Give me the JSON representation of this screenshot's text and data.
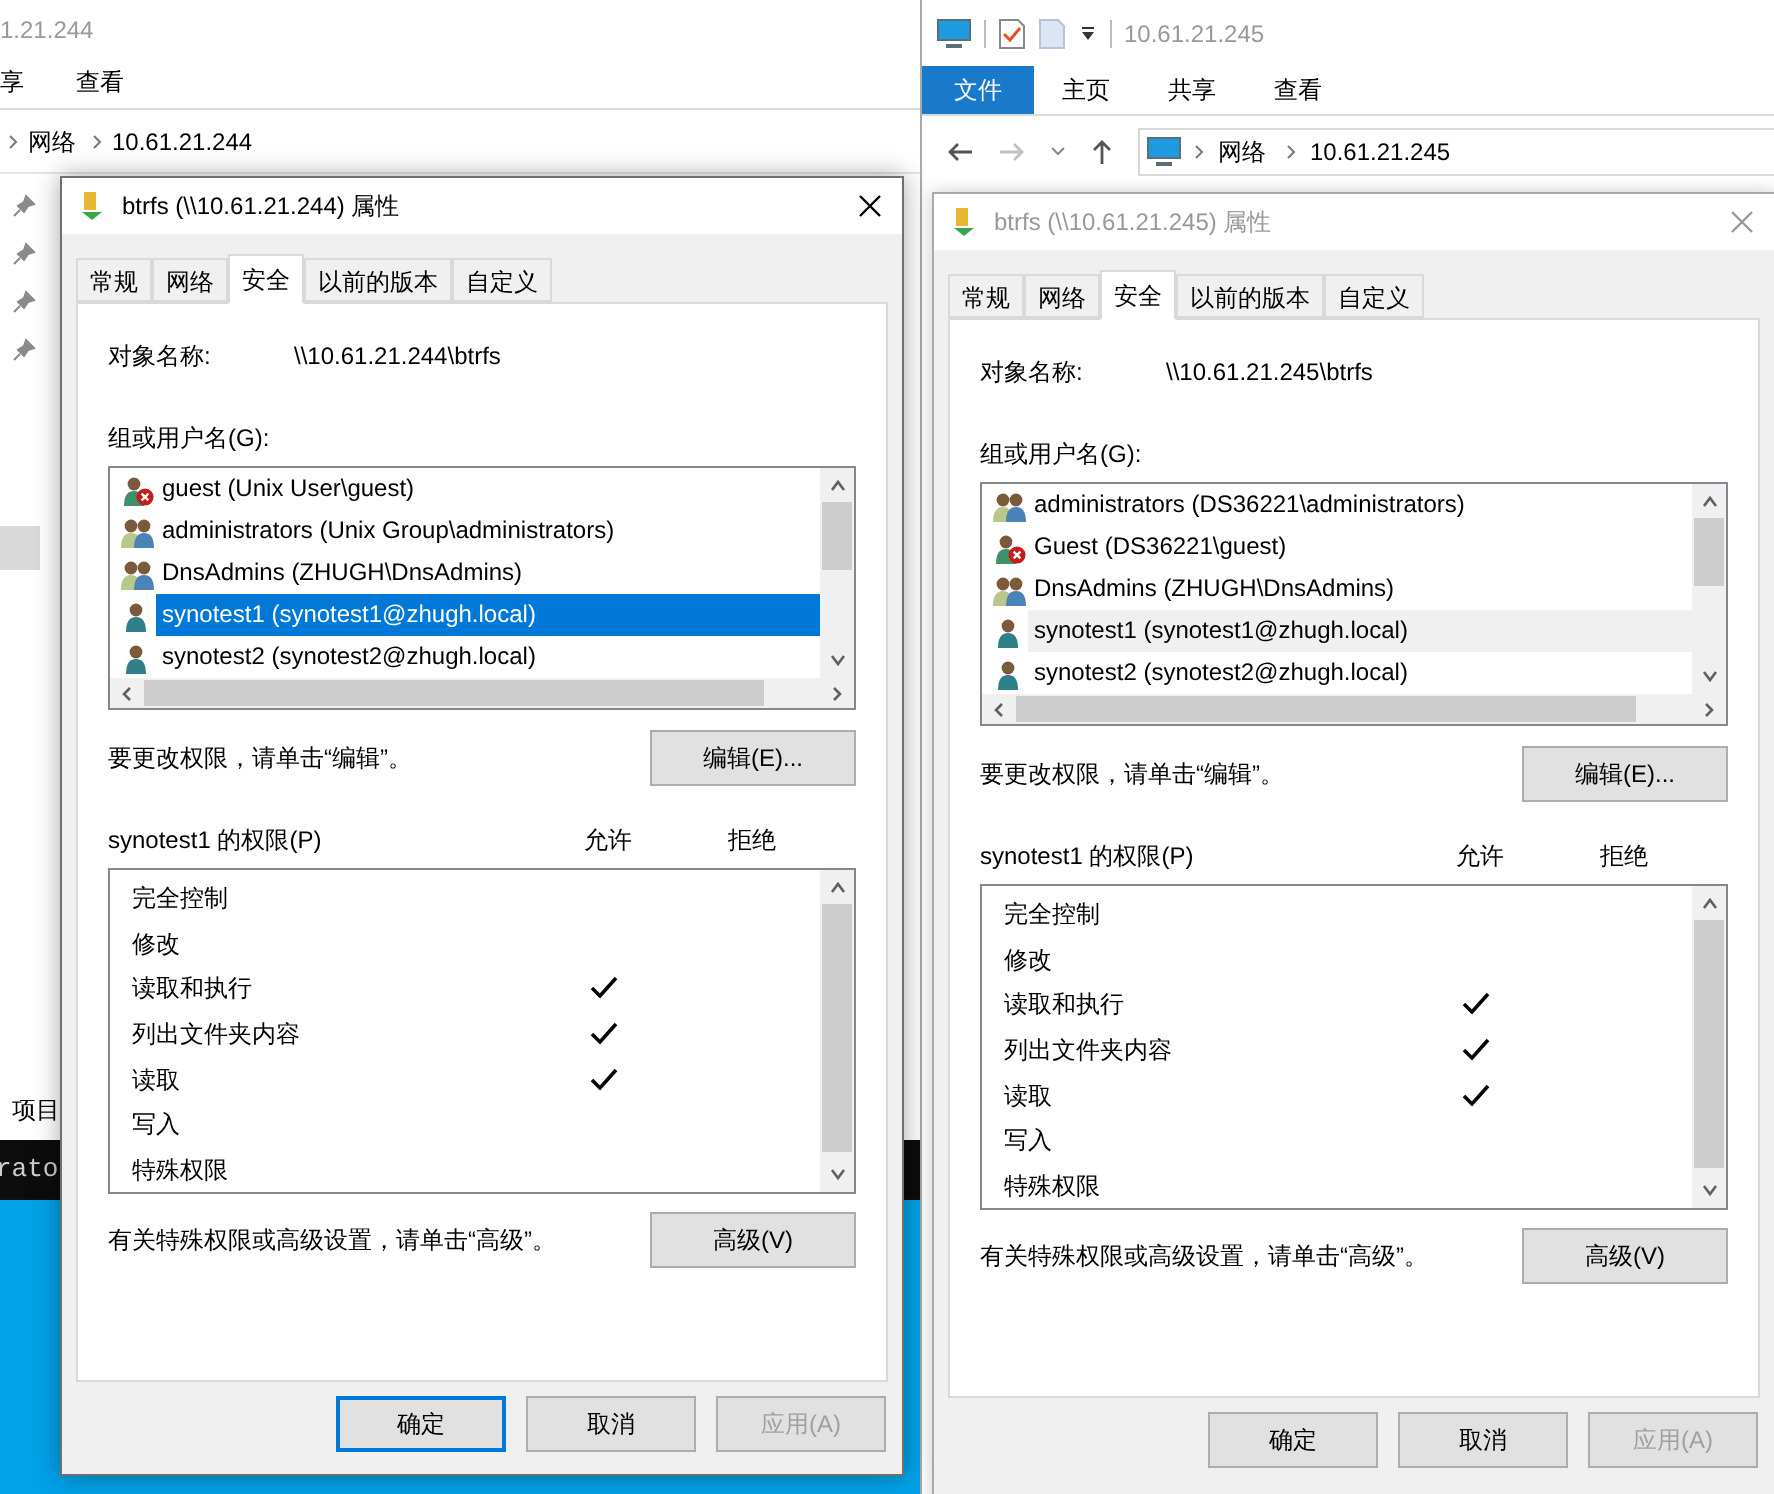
{
  "left_window": {
    "title": "1.21.244",
    "ribbon_tabs": [
      "享",
      "查看"
    ],
    "breadcrumb": [
      "网络",
      "10.61.21.244"
    ],
    "status": "项目",
    "terminal_text": "rato"
  },
  "right_window": {
    "title": "10.61.21.245",
    "ribbon_tabs": [
      {
        "label": "文件",
        "selected": true
      },
      {
        "label": "主页",
        "selected": false
      },
      {
        "label": "共享",
        "selected": false
      },
      {
        "label": "查看",
        "selected": false
      }
    ],
    "breadcrumb": [
      "网络",
      "10.61.21.245"
    ]
  },
  "dialogs": [
    {
      "title": "btrfs (\\\\10.61.21.244) 属性",
      "active": true,
      "tabs": [
        {
          "label": "常规",
          "selected": false
        },
        {
          "label": "网络",
          "selected": false
        },
        {
          "label": "安全",
          "selected": true
        },
        {
          "label": "以前的版本",
          "selected": false
        },
        {
          "label": "自定义",
          "selected": false
        }
      ],
      "object_label": "对象名称:",
      "object_name": "\\\\10.61.21.244\\btrfs",
      "group_label": "组或用户名(G):",
      "users": [
        {
          "name": "guest (Unix User\\guest)",
          "kind": "disabled_user",
          "selected": false
        },
        {
          "name": "administrators (Unix Group\\administrators)",
          "kind": "group",
          "selected": false
        },
        {
          "name": "DnsAdmins (ZHUGH\\DnsAdmins)",
          "kind": "group",
          "selected": false
        },
        {
          "name": "synotest1 (synotest1@zhugh.local)",
          "kind": "user",
          "selected": true
        },
        {
          "name": "synotest2 (synotest2@zhugh.local)",
          "kind": "user",
          "selected": false
        }
      ],
      "edit_hint": "要更改权限，请单击“编辑”。",
      "edit_button": "编辑(E)...",
      "perm_title": "synotest1 的权限(P)",
      "allow_header": "允许",
      "deny_header": "拒绝",
      "permissions": [
        {
          "name": "完全控制",
          "allow": false,
          "deny": false
        },
        {
          "name": "修改",
          "allow": false,
          "deny": false
        },
        {
          "name": "读取和执行",
          "allow": true,
          "deny": false
        },
        {
          "name": "列出文件夹内容",
          "allow": true,
          "deny": false
        },
        {
          "name": "读取",
          "allow": true,
          "deny": false
        },
        {
          "name": "写入",
          "allow": false,
          "deny": false
        },
        {
          "name": "特殊权限",
          "allow": false,
          "deny": false
        }
      ],
      "advanced_hint": "有关特殊权限或高级设置，请单击“高级”。",
      "advanced_button": "高级(V)",
      "buttons": [
        {
          "label": "确定",
          "disabled": false,
          "default": true
        },
        {
          "label": "取消",
          "disabled": false,
          "default": false
        },
        {
          "label": "应用(A)",
          "disabled": true,
          "default": false
        }
      ]
    },
    {
      "title": "btrfs (\\\\10.61.21.245) 属性",
      "active": false,
      "tabs": [
        {
          "label": "常规",
          "selected": false
        },
        {
          "label": "网络",
          "selected": false
        },
        {
          "label": "安全",
          "selected": true
        },
        {
          "label": "以前的版本",
          "selected": false
        },
        {
          "label": "自定义",
          "selected": false
        }
      ],
      "object_label": "对象名称:",
      "object_name": "\\\\10.61.21.245\\btrfs",
      "group_label": "组或用户名(G):",
      "users": [
        {
          "name": "administrators (DS36221\\administrators)",
          "kind": "group",
          "selected": false
        },
        {
          "name": "Guest (DS36221\\guest)",
          "kind": "disabled_user",
          "selected": false
        },
        {
          "name": "DnsAdmins (ZHUGH\\DnsAdmins)",
          "kind": "group",
          "selected": false
        },
        {
          "name": "synotest1 (synotest1@zhugh.local)",
          "kind": "user",
          "selected": true
        },
        {
          "name": "synotest2 (synotest2@zhugh.local)",
          "kind": "user",
          "selected": false
        }
      ],
      "edit_hint": "要更改权限，请单击“编辑”。",
      "edit_button": "编辑(E)...",
      "perm_title": "synotest1 的权限(P)",
      "allow_header": "允许",
      "deny_header": "拒绝",
      "permissions": [
        {
          "name": "完全控制",
          "allow": false,
          "deny": false
        },
        {
          "name": "修改",
          "allow": false,
          "deny": false
        },
        {
          "name": "读取和执行",
          "allow": true,
          "deny": false
        },
        {
          "name": "列出文件夹内容",
          "allow": true,
          "deny": false
        },
        {
          "name": "读取",
          "allow": true,
          "deny": false
        },
        {
          "name": "写入",
          "allow": false,
          "deny": false
        },
        {
          "name": "特殊权限",
          "allow": false,
          "deny": false
        }
      ],
      "advanced_hint": "有关特殊权限或高级设置，请单击“高级”。",
      "advanced_button": "高级(V)",
      "buttons": [
        {
          "label": "确定",
          "disabled": false,
          "default": false
        },
        {
          "label": "取消",
          "disabled": false,
          "default": false
        },
        {
          "label": "应用(A)",
          "disabled": true,
          "default": false
        }
      ]
    }
  ]
}
